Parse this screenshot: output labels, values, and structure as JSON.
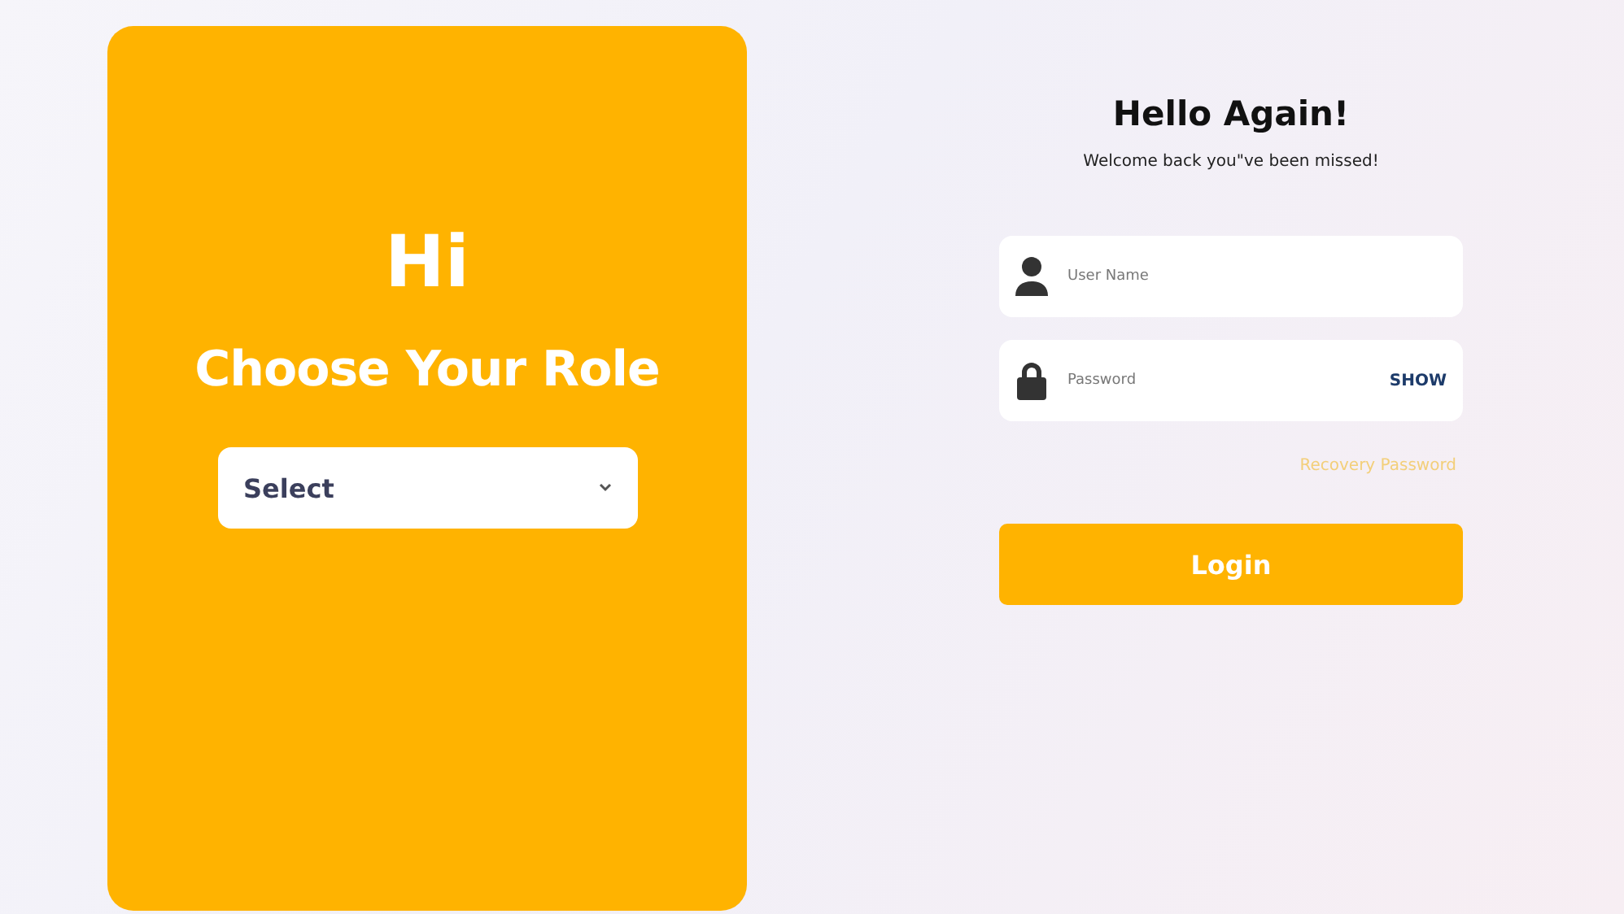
{
  "role_panel": {
    "greeting": "Hi",
    "heading": "Choose Your Role",
    "role_select": {
      "value": "Select"
    }
  },
  "login": {
    "title": "Hello Again!",
    "subtitle": "Welcome back  you\"ve been missed!",
    "fields": [
      {
        "kind": "user",
        "placeholder": "User Name"
      },
      {
        "kind": "password",
        "placeholder": "Password",
        "toggle": "SHOW"
      }
    ],
    "recovery_link": "Recovery Password",
    "submit": "Login"
  }
}
